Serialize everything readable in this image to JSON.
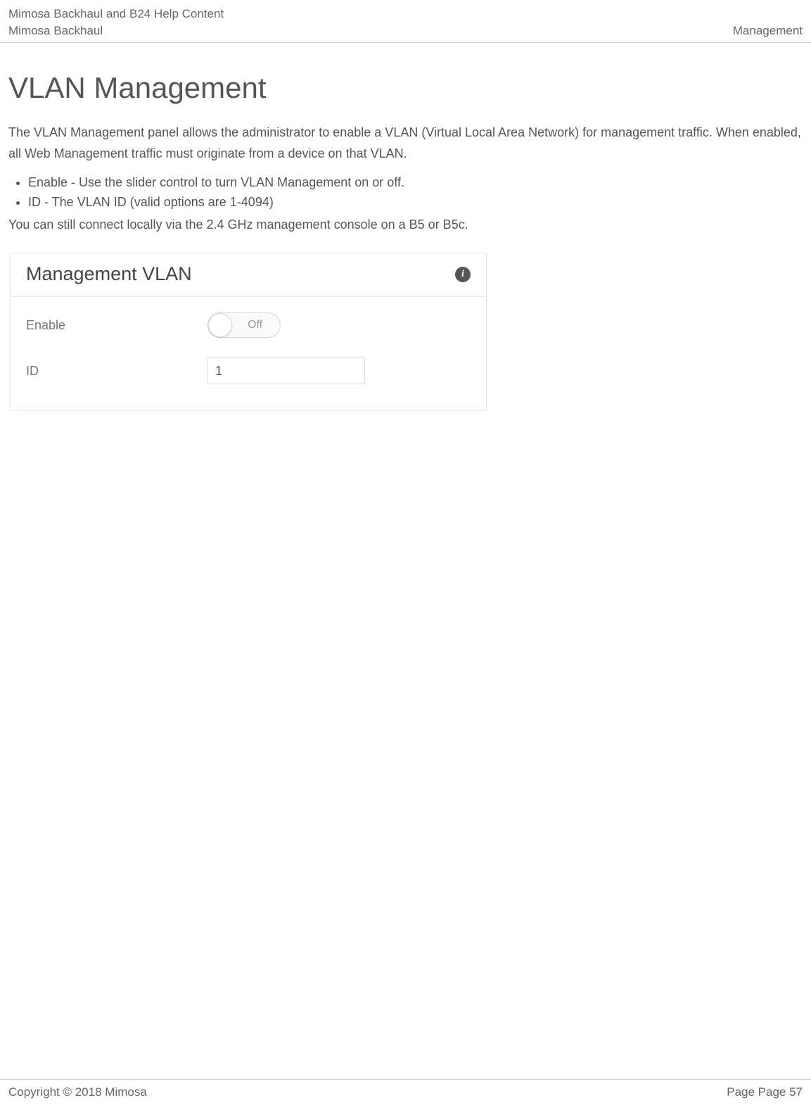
{
  "header": {
    "line1": "Mimosa Backhaul and B24 Help Content",
    "line2": "Mimosa Backhaul",
    "right": "Management"
  },
  "page": {
    "title": "VLAN Management",
    "intro": "The VLAN Management panel allows the administrator to enable a VLAN (Virtual Local Area Network) for management traffic. When enabled, all Web Management traffic must originate from a device on that VLAN.",
    "bullets": [
      "Enable - Use the slider control to turn VLAN Management on or off.",
      "ID - The VLAN ID (valid options are 1-4094)"
    ],
    "note": "You can still connect locally via the 2.4 GHz management console on a B5 or B5c."
  },
  "card": {
    "title": "Management VLAN",
    "info_icon_text": "i",
    "enable_label": "Enable",
    "enable_state": "Off",
    "id_label": "ID",
    "id_value": "1"
  },
  "footer": {
    "copyright": "Copyright © 2018 Mimosa",
    "page": "Page Page 57"
  }
}
